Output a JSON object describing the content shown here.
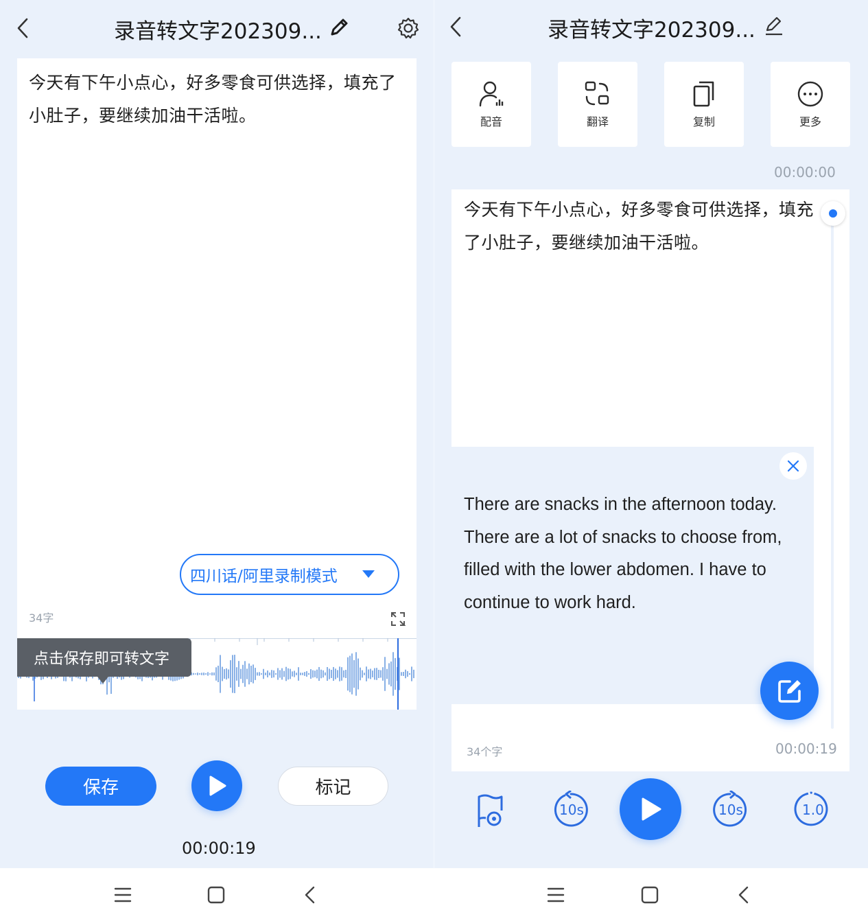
{
  "left": {
    "title": "录音转文字202309...",
    "transcript": "今天有下午小点心，好多零食可供选择，填充了小肚子，要继续加油干活啦。",
    "mode_pill": "四川话/阿里录制模式",
    "char_count": "34字",
    "tooltip": "点击保存即可转文字",
    "save_label": "保存",
    "mark_label": "标记",
    "time": "00:00:19"
  },
  "right": {
    "title": "录音转文字202309...",
    "tools": [
      {
        "label": "配音",
        "icon": "dubbing-icon"
      },
      {
        "label": "翻译",
        "icon": "translate-icon"
      },
      {
        "label": "复制",
        "icon": "copy-icon"
      },
      {
        "label": "更多",
        "icon": "more-icon"
      }
    ],
    "time_start": "00:00:00",
    "transcript": "今天有下午小点心，好多零食可供选择，填充了小肚子，要继续加油干活啦。",
    "translation": "There are snacks in the afternoon today. There are a lot of snacks to choose from, filled with the lower abdomen. I have to continue to work hard.",
    "char_count": "34个字",
    "time_end": "00:00:19",
    "rewind_label": "10s",
    "forward_label": "10s",
    "speed_label": "1.0"
  },
  "colors": {
    "accent": "#2378f7",
    "background": "#eaf1fb"
  }
}
